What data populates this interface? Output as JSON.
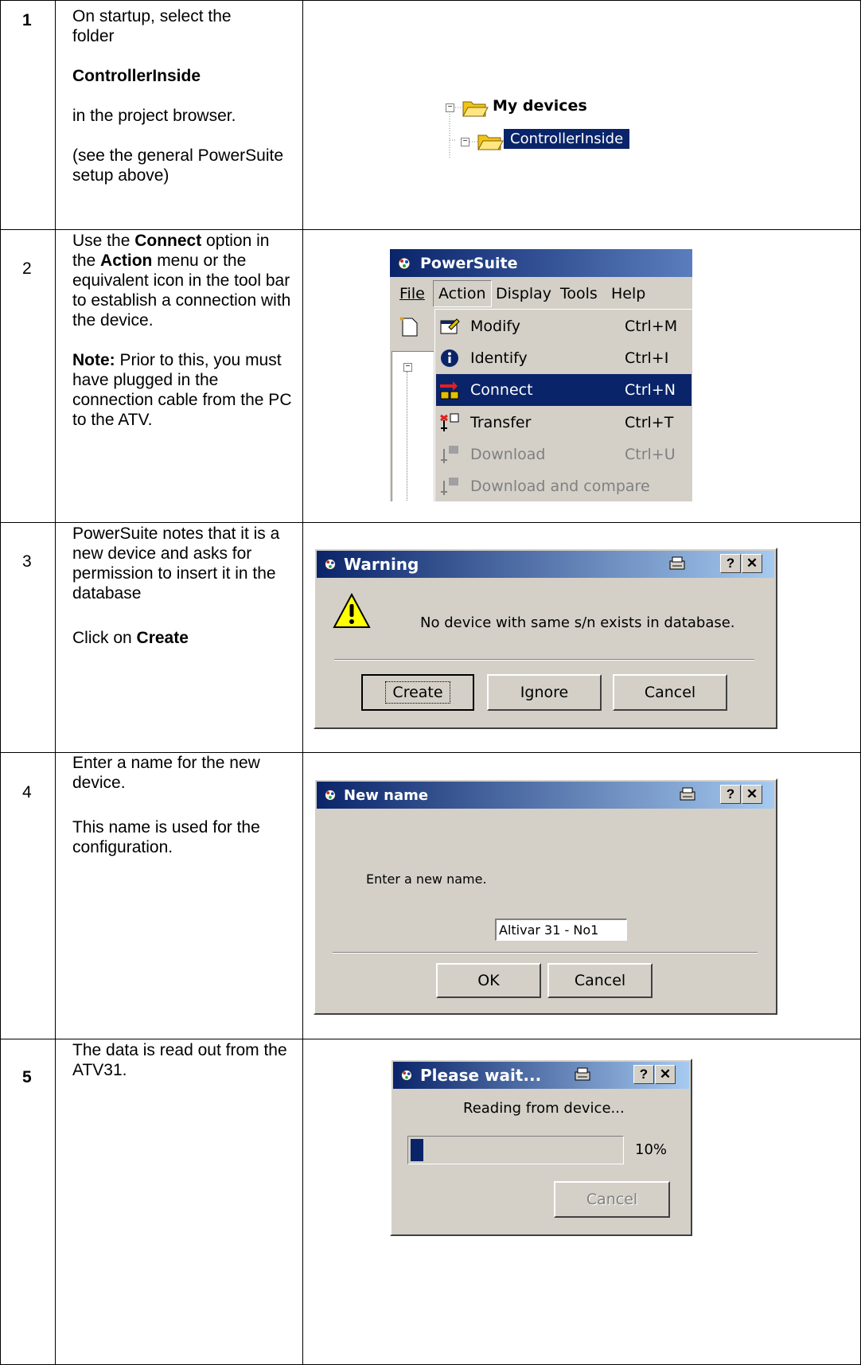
{
  "rows": [
    {
      "step": "1",
      "text": {
        "p1": "On startup, select the folder",
        "p2": "ControllerInside",
        "p3": "in the project browser.",
        "p4": "(see the general PowerSuite setup above)"
      },
      "tree": {
        "root": "My devices",
        "child": "ControllerInside"
      }
    },
    {
      "step": "2",
      "text": {
        "a": "Use the ",
        "connect": "Connect",
        "b": " option in the ",
        "action": "Action",
        "c": " menu or the equivalent icon in the tool bar to establish a connection with the device.",
        "note_label": "Note:",
        "note": " Prior to this, you must have plugged in the connection cable from the PC to the ATV."
      },
      "app": {
        "title": "PowerSuite",
        "menubar": [
          "File",
          "Action",
          "Display",
          "Tools",
          "Help"
        ],
        "menu_items": [
          {
            "label": "Modify",
            "accel": "Ctrl+M",
            "icon": "modify-icon"
          },
          {
            "label": "Identify",
            "accel": "Ctrl+I",
            "icon": "info-icon"
          },
          {
            "label": "Connect",
            "accel": "Ctrl+N",
            "icon": "connect-icon"
          },
          {
            "label": "Transfer",
            "accel": "Ctrl+T",
            "icon": "transfer-icon"
          },
          {
            "label": "Download",
            "accel": "Ctrl+U",
            "icon": "download-icon"
          },
          {
            "label": "Download and compare",
            "accel": "",
            "icon": "download-icon"
          }
        ]
      }
    },
    {
      "step": "3",
      "text": {
        "p1": "PowerSuite notes that it is a new device and asks for permission to insert it in the database",
        "p2a": "Click on ",
        "p2b": "Create"
      },
      "dialog": {
        "title": "Warning",
        "message": "No device with same s/n exists in database.",
        "buttons": [
          "Create",
          "Ignore",
          "Cancel"
        ]
      }
    },
    {
      "step": "4",
      "text": {
        "p1": "Enter a name for the new device.",
        "p2": "This name is used for the configuration."
      },
      "dialog": {
        "title": "New name",
        "prompt": "Enter a new name.",
        "input_value": "Altivar 31 - No1",
        "buttons": [
          "OK",
          "Cancel"
        ]
      }
    },
    {
      "step": "5",
      "text": {
        "p1": "The data is read out from the ATV31."
      },
      "dialog": {
        "title": "Please wait...",
        "message": "Reading from device...",
        "progress_text": "10%",
        "progress": 0.1,
        "button": "Cancel"
      }
    }
  ],
  "colors": {
    "titlebar_start": "#0a246a",
    "titlebar_end": "#a6caf0",
    "dialog_bg": "#d4d0c8",
    "selection": "#0a246a",
    "folder": "#f0c419"
  }
}
